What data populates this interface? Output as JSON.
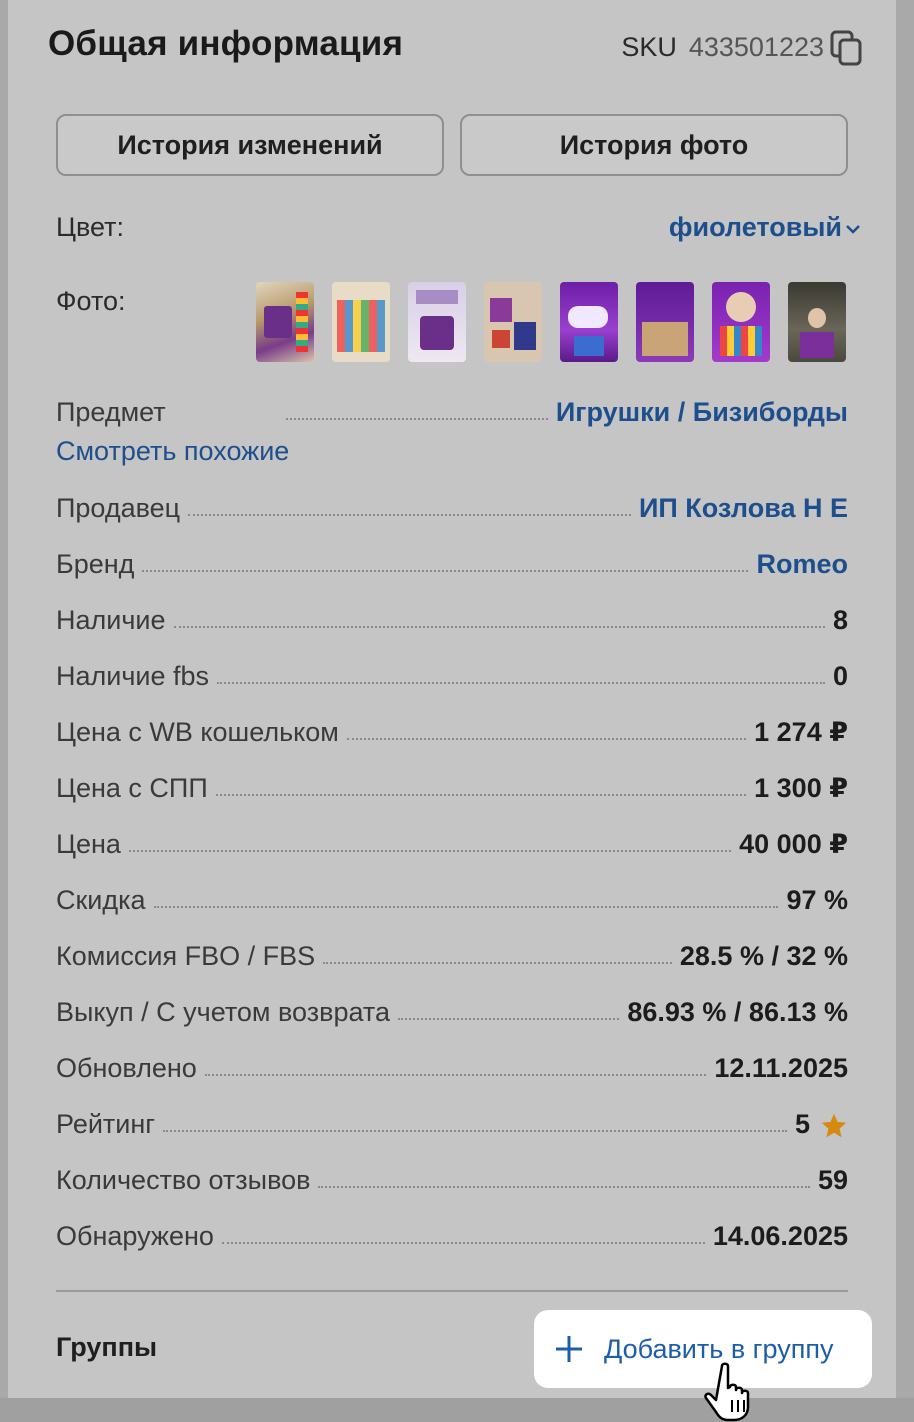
{
  "header": {
    "title": "Общая информация",
    "sku_label": "SKU",
    "sku_value": "433501223"
  },
  "buttons": {
    "history_changes": "История изменений",
    "history_photo": "История фото"
  },
  "color": {
    "label": "Цвет:",
    "value": "фиолетовый"
  },
  "photos": {
    "label": "Фото:",
    "count": 8
  },
  "subject": {
    "label": "Предмет",
    "value": "Игрушки / Бизиборды",
    "similar_link": "Смотреть похожие"
  },
  "details": [
    {
      "key": "Продавец",
      "value": "ИП Козлова Н Е"
    },
    {
      "key": "Бренд",
      "value": "Romeo"
    },
    {
      "key": "Наличие",
      "value": "8"
    },
    {
      "key": "Наличие fbs",
      "value": "0"
    },
    {
      "key": "Цена с WB кошельком",
      "value": "1 274 ₽"
    },
    {
      "key": "Цена с СПП",
      "value": "1 300 ₽"
    },
    {
      "key": "Цена",
      "value": "40 000 ₽"
    },
    {
      "key": "Скидка",
      "value": "97 %"
    },
    {
      "key": "Комиссия FBO / FBS",
      "value": "28.5 % / 32 %"
    },
    {
      "key": "Выкуп / С учетом возврата",
      "value": "86.93 % / 86.13 %"
    },
    {
      "key": "Обновлено",
      "value": "12.11.2025"
    },
    {
      "key": "Рейтинг",
      "value": "5"
    },
    {
      "key": "Количество отзывов",
      "value": "59"
    },
    {
      "key": "Обнаружено",
      "value": "14.06.2025"
    }
  ],
  "groups": {
    "label": "Группы",
    "add_button": "Добавить в группу"
  },
  "colors": {
    "link": "#1d4f8c",
    "star": "#d68a10"
  }
}
